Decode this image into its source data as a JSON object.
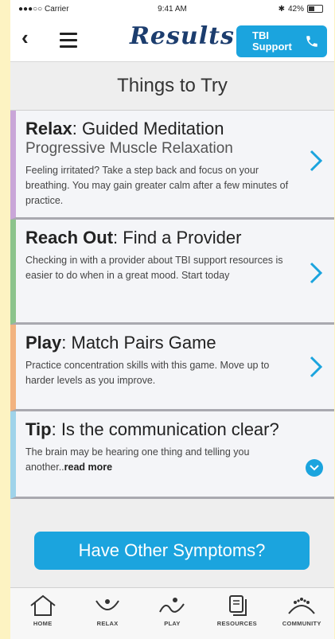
{
  "status_bar": {
    "carrier": "●●●○○ Carrier",
    "time": "9:41 AM",
    "battery": "42%"
  },
  "header": {
    "back_icon": "chevron-left-icon",
    "menu_icon": "hamburger-icon",
    "title": "Results",
    "support_label_line1": "TBI",
    "support_label_line2": "Support",
    "support_icon": "phone-icon"
  },
  "section": {
    "title": "Things to Try"
  },
  "cards": [
    {
      "category": "Relax",
      "title": ": Guided Meditation",
      "subtitle": "Progressive Muscle Relaxation",
      "description": "Feeling irritated? Take a step back and focus on your breathing. You may gain greater calm after a few minutes of practice.",
      "accent_color": "#c9a6d8"
    },
    {
      "category": "Reach Out",
      "title": ": Find a Provider",
      "description": "Checking in with a provider about TBI support resources is easier to do when in a great mood. Start today",
      "accent_color": "#8cc48c"
    },
    {
      "category": "Play",
      "title": ": Match Pairs Game",
      "description": "Practice concentration skills with this game. Move up to harder levels as you improve.",
      "accent_color": "#f2b380"
    },
    {
      "category": "Tip",
      "title": ": Is the communication clear?",
      "description": "The brain may be hearing one thing and telling you another..",
      "read_more": "read more",
      "accent_color": "#9fd3ea"
    }
  ],
  "symptoms_button": {
    "label": "Have Other Symptoms?"
  },
  "tabbar": {
    "items": [
      {
        "label": "HOME",
        "icon": "home-icon"
      },
      {
        "label": "RELAX",
        "icon": "relax-icon"
      },
      {
        "label": "PLAY",
        "icon": "play-icon"
      },
      {
        "label": "RESOURCES",
        "icon": "resources-icon"
      },
      {
        "label": "COMMUNITY",
        "icon": "community-icon"
      }
    ]
  },
  "colors": {
    "accent": "#1ba4de",
    "brand": "#1c3d6e",
    "page_bg": "#fdf3c2"
  }
}
